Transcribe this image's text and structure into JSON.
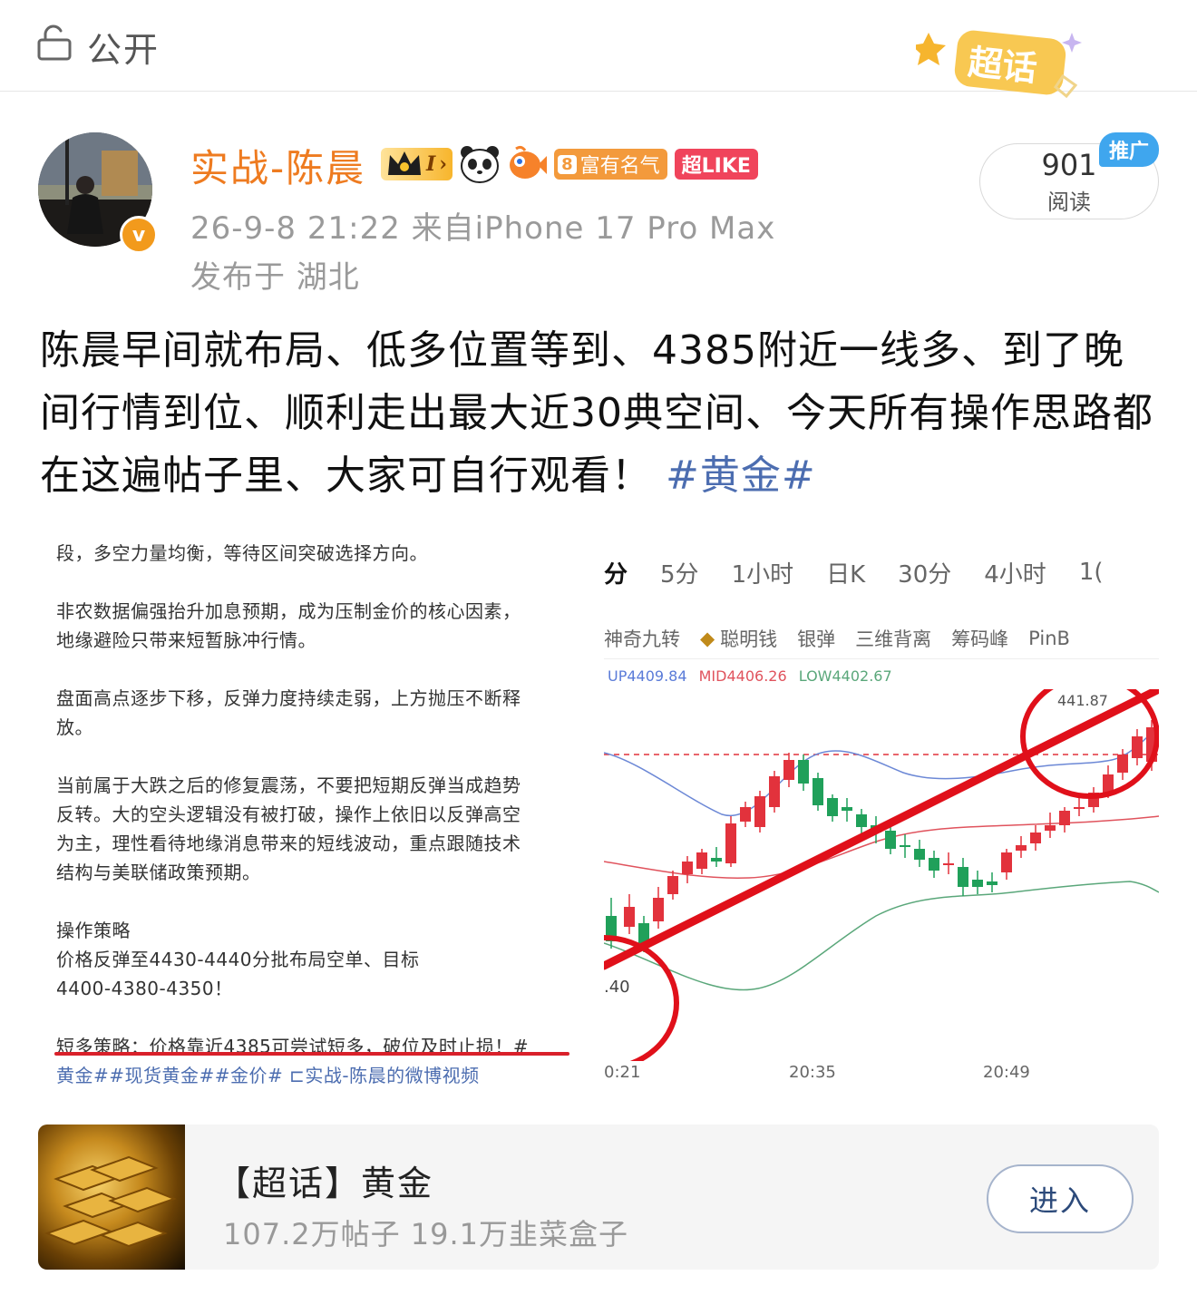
{
  "header": {
    "visibility": "公开",
    "supertopic_badge": "超话"
  },
  "author": {
    "name": "实战-陈晨",
    "level_badge": "I",
    "fame_level": "8",
    "fame_badge": "富有名气",
    "like_badge": "超LIKE",
    "verified_mark": "v"
  },
  "meta": {
    "time_source": "26-9-8 21:22  来自iPhone 17 Pro Max",
    "location": "发布于 湖北"
  },
  "stats": {
    "reads": "901",
    "reads_label": "阅读",
    "promo_tag": "推广"
  },
  "post": {
    "text": "陈晨早间就布局、低多位置等到、4385附近一线多、到了晚间行情到位、顺利走出最大近30典空间、今天所有操作思路都在这遍帖子里、大家可自行观看！",
    "hashtag": "#黄金#"
  },
  "screenshot_note": {
    "lines": [
      "段，多空力量均衡，等待区间突破选择方向。",
      "非农数据偏强抬升加息预期，成为压制金价的核心因素，",
      "地缘避险只带来短暂脉冲行情。",
      "盘面高点逐步下移，反弹力度持续走弱，上方抛压不断释",
      "放。",
      "当前属于大跌之后的修复震荡，不要把短期反弹当成趋势",
      "反转。大的空头逻辑没有被打破，操作上依旧以反弹高空",
      "为主，理性看待地缘消息带来的短线波动，重点跟随技术",
      "结构与美联储政策预期。",
      "操作策略",
      "价格反弹至4430-4440分批布局空单、目标",
      "4400-4380-4350！",
      "短多策略：价格靠近4385可尝试短多，破位及时止损！#"
    ],
    "link_line": "黄金##现货黄金##金价# ⊏实战-陈晨的微博视频"
  },
  "chart": {
    "timeframes": [
      "分",
      "5分",
      "1小时",
      "日K",
      "30分",
      "4小时",
      "1("
    ],
    "indicators": [
      "神奇九转",
      "聪明钱",
      "银弹",
      "三维背离",
      "筹码峰",
      "PinB"
    ],
    "boll_up": "UP4409.84",
    "boll_mid": "MID4406.26",
    "boll_low": "LOW4402.67",
    "price_label_high": "441.87",
    "price_label_low": ".40",
    "time_labels": [
      "0:21",
      "20:35",
      "20:49"
    ],
    "colors": {
      "up": "#e2323c",
      "down": "#20a05a",
      "annotation": "#e0101a"
    }
  },
  "topic_card": {
    "title": "【超话】黄金",
    "stats": "107.2万帖子 19.1万韭菜盒子",
    "enter_label": "进入"
  }
}
